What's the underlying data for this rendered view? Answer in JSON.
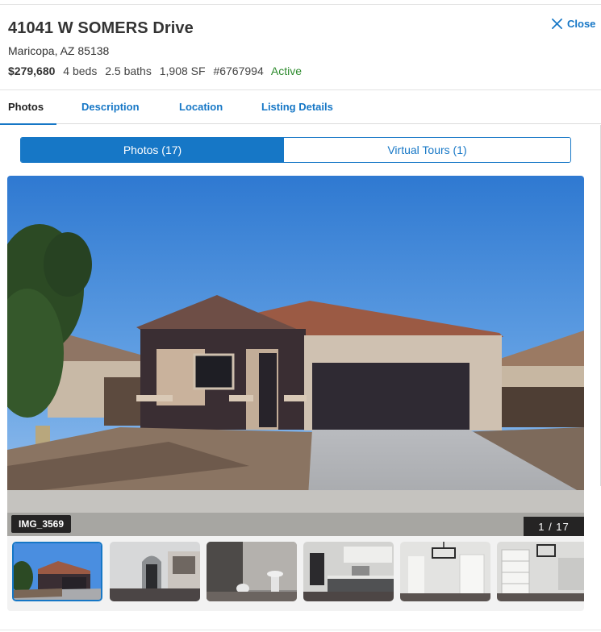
{
  "listing": {
    "address": "41041 W SOMERS Drive",
    "city_state_zip": "Maricopa, AZ 85138",
    "price": "$279,680",
    "beds": "4 beds",
    "baths": "2.5 baths",
    "sqft": "1,908 SF",
    "mls": "#6767994",
    "status": "Active"
  },
  "close_label": "Close",
  "tabs": [
    {
      "label": "Photos",
      "active": true
    },
    {
      "label": "Description",
      "active": false
    },
    {
      "label": "Location",
      "active": false
    },
    {
      "label": "Listing Details",
      "active": false
    }
  ],
  "media_toggle": {
    "photos_label": "Photos (17)",
    "tours_label": "Virtual Tours (1)",
    "selected": "photos"
  },
  "gallery": {
    "caption": "IMG_3569",
    "counter": "1 / 17",
    "thumbnails": [
      {
        "name": "exterior-front",
        "selected": true
      },
      {
        "name": "living-room-arch"
      },
      {
        "name": "half-bath"
      },
      {
        "name": "kitchen"
      },
      {
        "name": "dining-chandelier"
      },
      {
        "name": "pantry-shelves"
      }
    ]
  },
  "colors": {
    "accent": "#1677c6",
    "status_active": "#2e8b2e",
    "text": "#333333"
  },
  "icons": {
    "close": "close-x-icon"
  }
}
